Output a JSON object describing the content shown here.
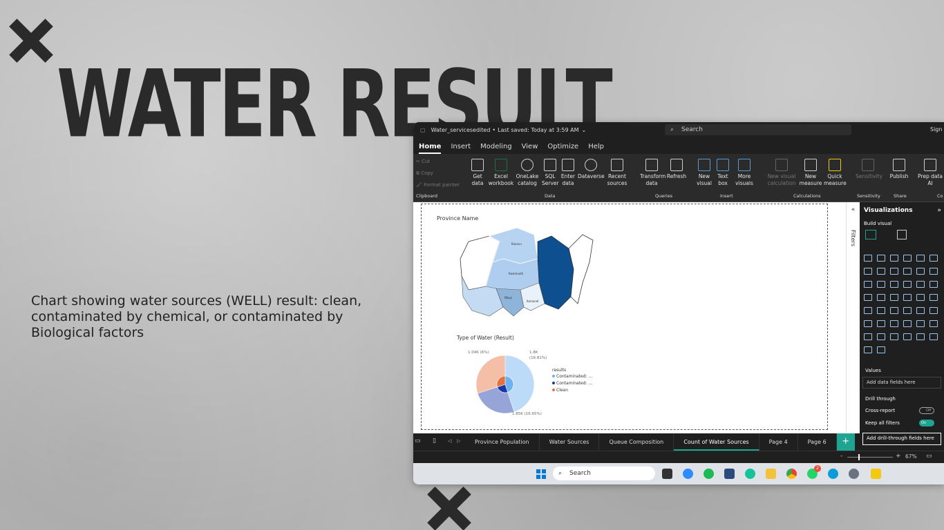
{
  "slide": {
    "title": "WATER RESULT",
    "description": "Chart showing water sources (WELL) result: clean, contaminated by chemical, or contaminated by Biological factors"
  },
  "app": {
    "file_name": "Water_servicesedited",
    "saved_status": "Last saved: Today at 3:59 AM",
    "search_placeholder": "Search",
    "sign_in": "Sign",
    "menu": [
      "Home",
      "Insert",
      "Modeling",
      "View",
      "Optimize",
      "Help"
    ],
    "clipboard": {
      "cut": "Cut",
      "copy": "Copy",
      "format_painter": "Format painter",
      "group": "Clipboard"
    },
    "ribbon": {
      "get_data": "Get data",
      "excel": "Excel workbook",
      "onelake": "OneLake catalog",
      "sql": "SQL Server",
      "enter_data": "Enter data",
      "dataverse": "Dataverse",
      "recent": "Recent sources",
      "transform": "Transform data",
      "refresh": "Refresh",
      "new_visual": "New visual",
      "text_box": "Text box",
      "more_visuals": "More visuals",
      "new_visual_calc": "New visual calculation",
      "new_measure": "New measure",
      "quick_measure": "Quick measure",
      "sensitivity": "Sensitivity",
      "publish": "Publish",
      "prep_data": "Prep data AI"
    },
    "groups": {
      "data": "Data",
      "queries": "Queries",
      "insert": "Insert",
      "calculations": "Calculations",
      "sensitivity": "Sensitivity",
      "share": "Share",
      "copilot": "Co"
    },
    "filters_label": "Filters",
    "visualizations": {
      "title": "Visualizations",
      "build_visual": "Build visual",
      "values_label": "Values",
      "add_data_fields": "Add data fields here",
      "drill_through": "Drill through",
      "cross_report": "Cross-report",
      "cross_report_state": "Off",
      "keep_all_filters": "Keep all filters",
      "keep_all_filters_state": "On",
      "add_drill_fields": "Add drill-through fields here"
    },
    "page_tabs": [
      "Province Population",
      "Water Sources",
      "Queue Composition",
      "Count of Water Sources",
      "Page 4",
      "Page 6"
    ],
    "active_tab": "Count of Water Sources",
    "zoom": "67%",
    "taskbar_search": "Search",
    "whatsapp_badge": "2"
  },
  "map_visual": {
    "title": "Province Name",
    "labels": [
      "Bukavu",
      "Kwamouth",
      "Mbuji",
      "Kamandi"
    ]
  },
  "chart_data": {
    "type": "pie",
    "title": "Type of Water (Result)",
    "legend_title": "results",
    "legend_position": "right",
    "series": [
      {
        "name": "Contaminated: ...",
        "color": "#6cb1f2",
        "label": "1.8K (16.81%)",
        "pct": 45
      },
      {
        "name": "Contaminated: ...",
        "color": "#1a37a8",
        "label": "1.85K (16.65%)",
        "pct": 25
      },
      {
        "name": "Clean",
        "color": "#e7713e",
        "label": "1.04K (6%)",
        "pct": 30
      }
    ],
    "data_labels": [
      "1.04K (6%)",
      "1.8K",
      "(16.81%)",
      "1.85K (16.65%)"
    ]
  }
}
